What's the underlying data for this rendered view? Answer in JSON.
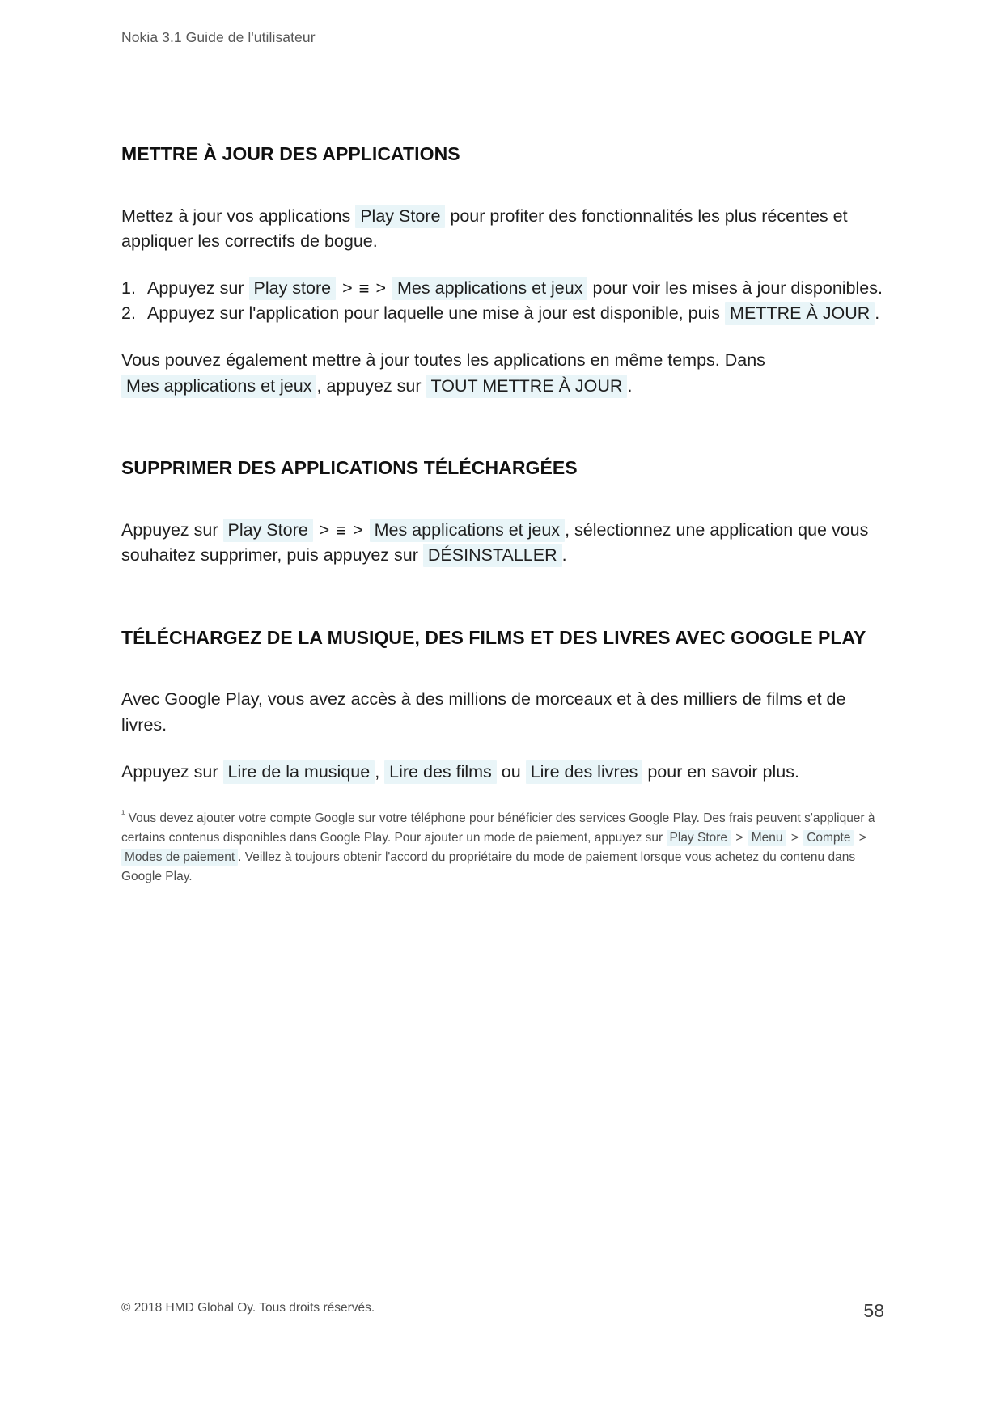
{
  "document": {
    "running_header": "Nokia 3.1 Guide de l'utilisateur",
    "page_number": "58",
    "copyright": "© 2018 HMD Global Oy. Tous droits réservés.",
    "chip_background_color": "#e9f5f8",
    "text_color": "#1f1f1f",
    "header_color": "#585858"
  },
  "sections": {
    "update_apps": {
      "heading": "METTRE À JOUR DES APPLICATIONS",
      "intro": {
        "before": "Mettez à jour vos applications",
        "chip": "Play Store",
        "after": "pour profiter des fonctionnalités les plus récentes et appliquer les correctifs de bogue."
      },
      "steps": [
        {
          "lead": "Appuyez sur",
          "chip1": "Play store",
          "sep1": ">",
          "icon": "≡",
          "sep2": ">",
          "chip2": "Mes applications et jeux",
          "tail": "pour voir les mises à jour disponibles."
        },
        {
          "lead": "Appuyez sur l'application pour laquelle une mise à jour est disponible, puis",
          "chip1": "METTRE À JOUR",
          "tail": "."
        }
      ],
      "outro": {
        "line1": "Vous pouvez également mettre à jour toutes les applications en même temps. Dans",
        "chip1": "Mes applications et jeux",
        "mid": ", appuyez sur",
        "chip2": "TOUT METTRE À JOUR",
        "tail": "."
      }
    },
    "remove_apps": {
      "heading": "SUPPRIMER DES APPLICATIONS TÉLÉCHARGÉES",
      "body": {
        "lead": "Appuyez sur",
        "chip1": "Play Store",
        "sep1": ">",
        "icon": "≡",
        "sep2": ">",
        "chip2": "Mes applications et jeux",
        "mid": ", sélectionnez une application que vous souhaitez supprimer, puis appuyez sur",
        "chip3": "DÉSINSTALLER",
        "tail": "."
      }
    },
    "google_play": {
      "heading": "TÉLÉCHARGEZ DE LA MUSIQUE, DES FILMS ET DES LIVRES AVEC GOOGLE PLAY",
      "paragraph": "Avec Google Play, vous avez accès à des millions de morceaux et à des milliers de films et de livres.",
      "action": {
        "lead": "Appuyez sur",
        "chip1": "Lire de la musique",
        "comma": ",",
        "chip2": "Lire des films",
        "conj": "ou",
        "chip3": "Lire des livres",
        "tail": "pour en savoir plus."
      }
    }
  },
  "footnote": {
    "marker": "¹",
    "part1": "Vous devez ajouter votre compte Google sur votre téléphone pour bénéficier des services Google Play. Des frais peuvent s'appliquer à certains contenus disponibles dans Google Play. Pour ajouter un mode de paiement, appuyez sur",
    "chip1": "Play Store",
    "sep1": ">",
    "chip2": "Menu",
    "sep2": ">",
    "chip3": "Compte",
    "sep3": ">",
    "chip4": "Modes de paiement",
    "part2": ". Veillez à toujours obtenir l'accord du propriétaire du mode de paiement lorsque vous achetez du contenu dans Google Play."
  }
}
